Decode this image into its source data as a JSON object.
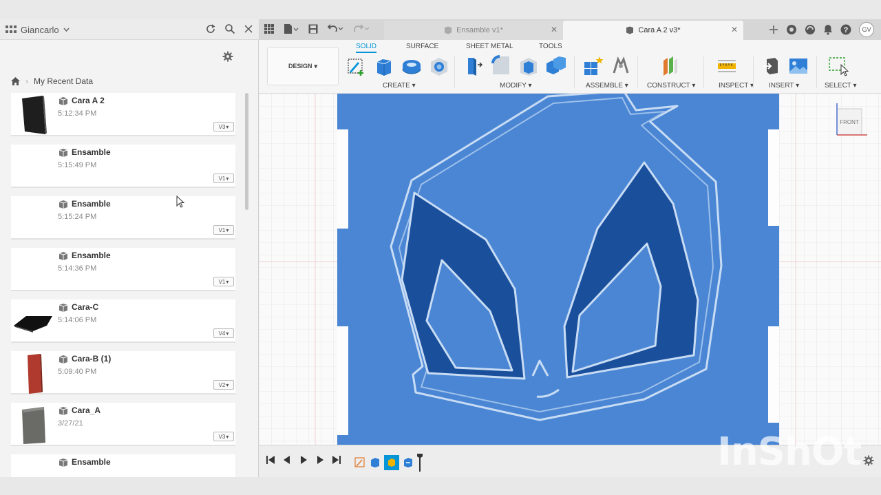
{
  "user": {
    "name": "Giancarlo"
  },
  "breadcrumb": {
    "label": "My Recent Data"
  },
  "recent_items": [
    {
      "name": "Cara A 2",
      "time": "5:12:34 PM",
      "version": "V3",
      "thumb": "black-panel"
    },
    {
      "name": "Ensamble",
      "time": "5:15:49 PM",
      "version": "V1",
      "thumb": "none"
    },
    {
      "name": "Ensamble",
      "time": "5:15:24 PM",
      "version": "V1",
      "thumb": "none"
    },
    {
      "name": "Ensamble",
      "time": "5:14:36 PM",
      "version": "V1",
      "thumb": "none"
    },
    {
      "name": "Cara-C",
      "time": "5:14:06 PM",
      "version": "V4",
      "thumb": "black-flat"
    },
    {
      "name": "Cara-B (1)",
      "time": "5:09:40 PM",
      "version": "V2",
      "thumb": "red-panel"
    },
    {
      "name": "Cara_A",
      "time": "3/27/21",
      "version": "V3",
      "thumb": "grey-panel"
    },
    {
      "name": "Ensamble",
      "time": "",
      "version": "",
      "thumb": "none"
    }
  ],
  "tabs": [
    {
      "label": "Ensamble v1*",
      "active": false
    },
    {
      "label": "Cara A 2 v3*",
      "active": true
    }
  ],
  "avatar": "GV",
  "workspace": {
    "label": "DESIGN"
  },
  "subtabs": [
    "SOLID",
    "SURFACE",
    "SHEET METAL",
    "TOOLS"
  ],
  "tool_groups": [
    "CREATE",
    "MODIFY",
    "ASSEMBLE",
    "CONSTRUCT",
    "INSPECT",
    "INSERT",
    "SELECT"
  ],
  "viewcube": {
    "face": "FRONT"
  },
  "watermark": "InShOt",
  "colors": {
    "model_blue": "#4a86d4",
    "dark_blue": "#1a4f9c",
    "accent": "#0696d7"
  }
}
